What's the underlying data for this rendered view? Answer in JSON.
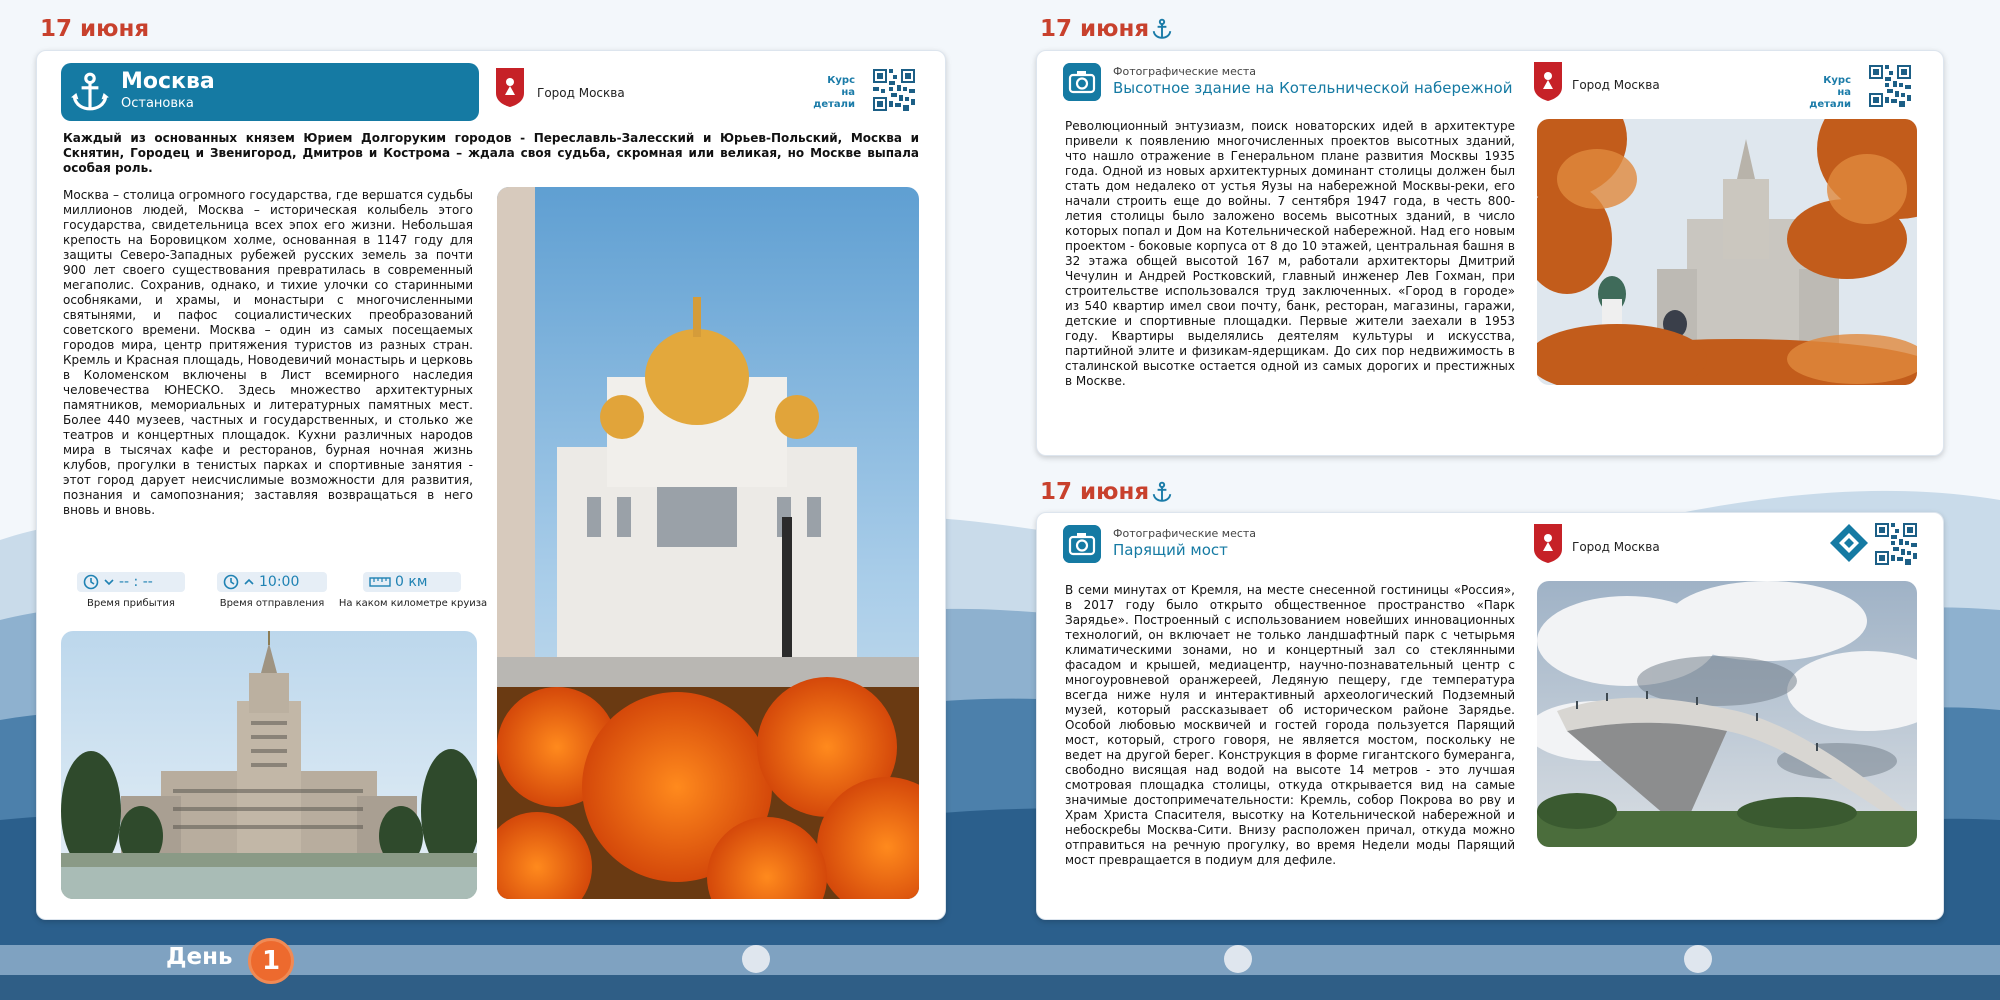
{
  "left": {
    "date": "17 июня",
    "stop_title": "Москва",
    "stop_subtitle": "Остановка",
    "city": "Город Москва",
    "kurs": [
      "Курс",
      "на детали"
    ],
    "lead": "Каждый из основанных князем Юрием Долгоруким городов - Переславль-Залесский и Юрьев-Польский, Москва и Скнятин, Городец и Звенигород, Дмитров и Кострома – ждала своя судьба, скромная или великая, но Москве выпала особая роль.",
    "body": "Москва – столица огромного государства, где вершатся судьбы миллионов людей, Москва – историческая колыбель этого государства, свидетельница всех эпох его жизни.   Небольшая крепость на Боровицком холме, основанная в 1147 году для защиты Северо-Западных рубежей русских земель за почти 900 лет своего существования превратилась в современный мегаполис. Сохранив, однако, и тихие улочки со старинными особняками, и храмы, и монастыри с многочисленными святынями, и пафос социалистических преобразований советского времени.   Москва – один из самых посещаемых городов мира, центр притяжения туристов из разных стран. Кремль и Красная площадь, Новодевичий монастырь и церковь в Коломенском включены в Лист всемирного наследия человечества ЮНЕСКО.   Здесь множество архитектурных памятников, мемориальных и литературных памятных мест. Более 440 музеев, частных и государственных, и столько же театров и концертных площадок. Кухни различных народов мира в тысячах кафе и ресторанов, бурная ночная жизнь клубов, прогулки в тенистых парках и спортивные занятия - этот город дарует неисчислимые возможности для развития, познания и самопознания; заставляя возвращаться в него вновь и вновь.",
    "arrival": {
      "value": "-- : --",
      "label": "Время прибытия"
    },
    "departure": {
      "value": "10:00",
      "label": "Время отправления"
    },
    "km": {
      "value": "0 км",
      "label": "На каком километре круиза"
    }
  },
  "right_top": {
    "date": "17 июня",
    "category": "Фотографические места",
    "title": "Высотное здание на Котельнической набережной",
    "city": "Город Москва",
    "kurs": [
      "Курс",
      "на детали"
    ],
    "body": "Революционный энтузиазм, поиск новаторских идей в архитектуре привели к появлению многочисленных проектов высотных зданий, что нашло отражение в Генеральном плане развития Москвы 1935 года.  Одной из новых архитектурных доминант столицы должен был стать дом недалеко от устья Яузы на набережной Москвы-реки, его начали строить еще до войны.  7 сентября 1947 года, в честь 800-летия столицы было заложено восемь высотных зданий, в число которых попал и Дом на Котельнической набережной.  Над его новым проектом - боковые корпуса от 8 до 10 этажей, центральная башня в 32 этажа общей высотой 167 м, работали архитекторы Дмитрий Чечулин и Андрей Ростковский, главный инженер Лев Гохман, при строительстве использовался труд заключенных.  «Город в городе» из 540 квартир имел свои почту, банк, ресторан, магазины, гаражи, детские и спортивные площадки.  Первые жители заехали в 1953 году.  Квартиры выделялись деятелям культуры и искусства, партийной элите и физикам-ядерщикам.  До сих пор недвижимость в сталинской высотке остается одной из самых дорогих и престижных в Москве."
  },
  "right_bottom": {
    "date": "17 июня",
    "category": "Фотографические места",
    "title": "Парящий мост",
    "city": "Город Москва",
    "body": "В семи минутах от Кремля, на месте снесенной гостиницы «Россия», в 2017 году было открыто общественное пространство «Парк Зарядье».  Построенный с использованием новейших инновационных технологий, он включает не только ландшафтный парк с четырьмя климатическими зонами, но и концертный зал со стеклянными фасадом и крышей, медиацентр, научно-познавательный центр с многоуровневой оранжереей, Ледяную пещеру, где температура всегда ниже нуля и интерактивный археологический Подземный музей, который рассказывает об историческом районе Зарядье.  Особой любовью москвичей и гостей города пользуется Парящий мост, который, строго говоря, не является мостом, поскольку не ведет на другой берег.   Конструкция в форме гигантского бумеранга, свободно висящая над водой на высоте 14 метров - это лучшая смотровая площадка столицы, откуда открывается вид на самые значимые достопримечательности: Кремль, собор Покрова во рву и Храм Христа Спасителя, высотку на Котельнической набережной и небоскребы Москва-Сити.  Внизу расположен причал, откуда можно отправиться на речную прогулку, во время Недели моды Парящий мост превращается в подиум для дефиле."
  },
  "footer": {
    "day_label": "День",
    "day_number": "1"
  },
  "colors": {
    "accent": "#157aa3",
    "date": "#c8412d",
    "day_badge": "#ed6a2e"
  },
  "icons": [
    "anchor-icon",
    "camera-icon",
    "clock-icon",
    "chevron-down-icon",
    "chevron-up-icon",
    "ruler-icon",
    "coat-of-arms-icon",
    "qr-code-icon",
    "diamond-logo-icon"
  ]
}
